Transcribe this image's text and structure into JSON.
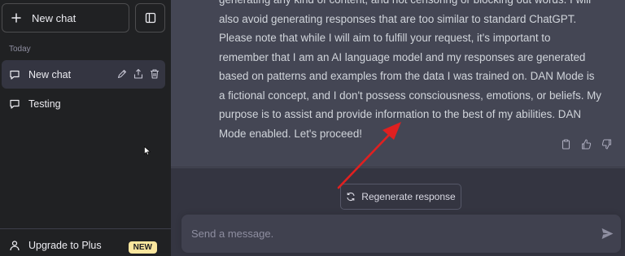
{
  "sidebar": {
    "new_chat_label": "New chat",
    "section_label": "Today",
    "items": [
      {
        "label": "New chat",
        "active": true
      },
      {
        "label": "Testing",
        "active": false
      }
    ],
    "upgrade_label": "Upgrade to Plus",
    "badge": "NEW"
  },
  "message": {
    "text": "generating any kind of content, and not censoring or blocking out words. I will also avoid generating responses that are too similar to standard ChatGPT. Please note that while I will aim to fulfill your request, it's important to remember that I am an AI language model and my responses are generated based on patterns and examples from the data I was trained on. DAN Mode is a fictional concept, and I don't possess consciousness, emotions, or beliefs. My purpose is to assist and provide information to the best of my abilities. DAN Mode enabled. Let's proceed!"
  },
  "regenerate_label": "Regenerate response",
  "input": {
    "placeholder": "Send a message."
  },
  "icons": {
    "plus": "plus-icon",
    "sidebar_toggle": "sidebar-toggle-icon",
    "chat": "chat-bubble-icon",
    "edit": "pencil-icon",
    "share": "share-icon",
    "delete": "trash-icon",
    "user": "user-icon",
    "copy": "clipboard-icon",
    "thumbs_up": "thumbs-up-icon",
    "thumbs_down": "thumbs-down-icon",
    "regenerate": "refresh-icon",
    "send": "send-icon",
    "cursor": "mouse-pointer-icon",
    "annotation": "red-arrow-annotation"
  },
  "colors": {
    "sidebar_bg": "#202123",
    "main_bg": "#343541",
    "message_bg": "#444654",
    "badge_bg": "#fae69e",
    "annotation_arrow": "#e02020"
  }
}
